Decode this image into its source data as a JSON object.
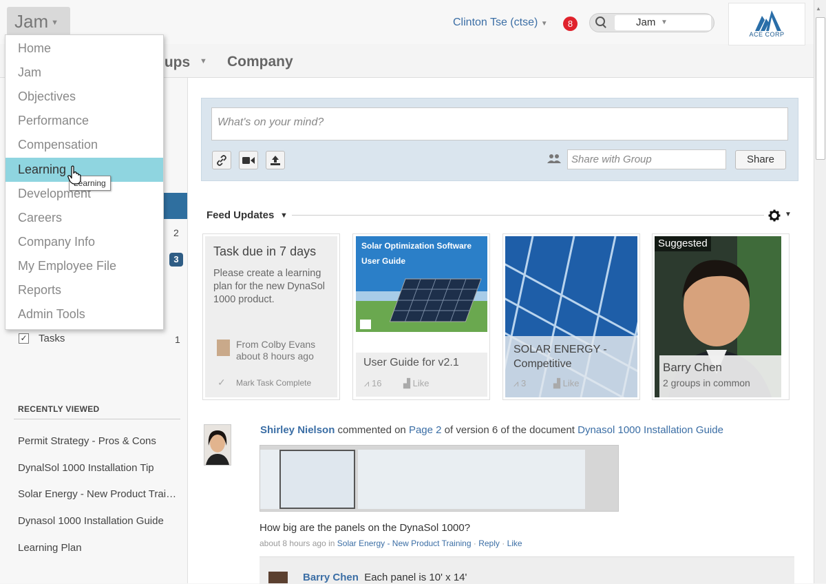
{
  "header": {
    "app_menu_label": "Jam",
    "user_name": "Clinton Tse (ctse)",
    "notification_count": "8",
    "search_scope": "Jam",
    "logo_text": "ACE CORP"
  },
  "nav": {
    "groups_label": "oups",
    "company_label": "Company"
  },
  "menu": {
    "items": [
      "Home",
      "Jam",
      "Objectives",
      "Performance",
      "Compensation",
      "Learning",
      "Development",
      "Careers",
      "Company Info",
      "My Employee File",
      "Reports",
      "Admin Tools"
    ],
    "active": "Learning",
    "tooltip": "Learning"
  },
  "sidebar": {
    "count_a": "2",
    "badge_b": "3",
    "tasks_label": "Tasks",
    "tasks_count": "1",
    "recent_heading": "RECENTLY VIEWED",
    "recent": [
      "Permit Strategy - Pros & Cons",
      "DynalSol 1000 Installation Tip",
      "Solar Energy - New Product Training",
      "Dynasol 1000 Installation Guide",
      "Learning Plan"
    ]
  },
  "composer": {
    "placeholder": "What's on your mind?",
    "share_placeholder": "Share with Group",
    "share_button": "Share"
  },
  "feed": {
    "title": "Feed Updates",
    "task_card": {
      "title": "Task due in 7 days",
      "body": "Please create a learning plan for the new DynaSol 1000 product.",
      "from": "From Colby Evans",
      "time": "about 8 hours ago",
      "action": "Mark Task Complete"
    },
    "doc_card": {
      "cover_title1": "Solar Optimization Software",
      "cover_title2": "User Guide",
      "name": "User Guide for v2.1",
      "views": "16",
      "like": "Like"
    },
    "solar_card": {
      "name": "SOLAR ENERGY - Competitive",
      "views": "3",
      "like": "Like"
    },
    "person_card": {
      "badge": "Suggested",
      "name": "Barry Chen",
      "groups": "2 groups in common"
    }
  },
  "activity": {
    "actor": "Shirley Nielson",
    "text1": "commented on",
    "page_link": "Page 2",
    "text2": "of version 6 of the document",
    "doc_link": "Dynasol 1000 Installation Guide",
    "question": "How big are the panels on the DynaSol 1000?",
    "meta_time": "about 8 hours ago in",
    "meta_group": "Solar Energy - New Product Training",
    "meta_reply": "Reply",
    "meta_like": "Like",
    "reply_author": "Barry Chen",
    "reply_text": "Each panel is 10' x 14'"
  },
  "colors": {
    "accent_blue": "#3b6ea5",
    "menu_active": "#8fd5e0",
    "notif_red": "#e0222c"
  }
}
